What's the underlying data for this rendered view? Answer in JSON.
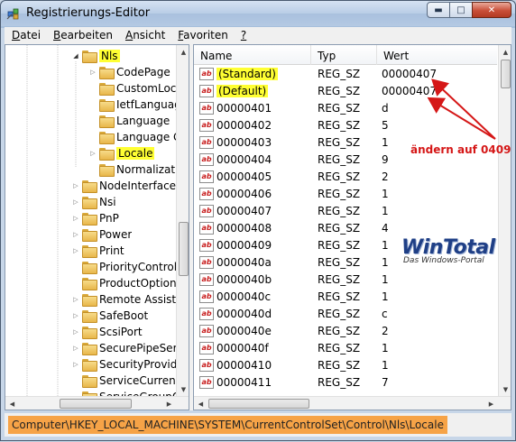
{
  "window": {
    "title": "Registrierungs-Editor"
  },
  "menu": [
    {
      "accel": "D",
      "rest": "atei"
    },
    {
      "accel": "B",
      "rest": "earbeiten"
    },
    {
      "accel": "A",
      "rest": "nsicht"
    },
    {
      "accel": "F",
      "rest": "avoriten"
    },
    {
      "accel": "?",
      "rest": ""
    }
  ],
  "tree": {
    "items": [
      {
        "label": "Nls",
        "expander": "open",
        "highlighted": true,
        "selected": false
      },
      {
        "label": "CodePage",
        "expander": "closed",
        "highlighted": false,
        "selected": false
      },
      {
        "label": "CustomLoc",
        "expander": "none",
        "highlighted": false,
        "selected": false
      },
      {
        "label": "IetfLanguag",
        "expander": "none",
        "highlighted": false,
        "selected": false
      },
      {
        "label": "Language",
        "expander": "none",
        "highlighted": false,
        "selected": false
      },
      {
        "label": "Language G",
        "expander": "none",
        "highlighted": false,
        "selected": false
      },
      {
        "label": "Locale",
        "expander": "closed",
        "highlighted": true,
        "selected": true
      },
      {
        "label": "Normalizati",
        "expander": "none",
        "highlighted": false,
        "selected": false
      },
      {
        "label": "NodeInterfaces",
        "expander": "closed",
        "highlighted": false,
        "selected": false
      },
      {
        "label": "Nsi",
        "expander": "closed",
        "highlighted": false,
        "selected": false
      },
      {
        "label": "PnP",
        "expander": "closed",
        "highlighted": false,
        "selected": false
      },
      {
        "label": "Power",
        "expander": "closed",
        "highlighted": false,
        "selected": false
      },
      {
        "label": "Print",
        "expander": "closed",
        "highlighted": false,
        "selected": false
      },
      {
        "label": "PriorityControl",
        "expander": "none",
        "highlighted": false,
        "selected": false
      },
      {
        "label": "ProductOptions",
        "expander": "none",
        "highlighted": false,
        "selected": false
      },
      {
        "label": "Remote Assista",
        "expander": "closed",
        "highlighted": false,
        "selected": false
      },
      {
        "label": "SafeBoot",
        "expander": "closed",
        "highlighted": false,
        "selected": false
      },
      {
        "label": "ScsiPort",
        "expander": "closed",
        "highlighted": false,
        "selected": false
      },
      {
        "label": "SecurePipeServ",
        "expander": "closed",
        "highlighted": false,
        "selected": false
      },
      {
        "label": "SecurityProvide",
        "expander": "closed",
        "highlighted": false,
        "selected": false
      },
      {
        "label": "ServiceCurrent",
        "expander": "none",
        "highlighted": false,
        "selected": false
      },
      {
        "label": "ServiceGroupOr",
        "expander": "none",
        "highlighted": false,
        "selected": false
      }
    ]
  },
  "list": {
    "columns": [
      "Name",
      "Typ",
      "Wert"
    ],
    "rows": [
      {
        "name": "(Standard)",
        "type": "REG_SZ",
        "value": "00000407",
        "highlighted": true
      },
      {
        "name": "(Default)",
        "type": "REG_SZ",
        "value": "00000407",
        "highlighted": true
      },
      {
        "name": "00000401",
        "type": "REG_SZ",
        "value": "d",
        "highlighted": false
      },
      {
        "name": "00000402",
        "type": "REG_SZ",
        "value": "5",
        "highlighted": false
      },
      {
        "name": "00000403",
        "type": "REG_SZ",
        "value": "1",
        "highlighted": false
      },
      {
        "name": "00000404",
        "type": "REG_SZ",
        "value": "9",
        "highlighted": false
      },
      {
        "name": "00000405",
        "type": "REG_SZ",
        "value": "2",
        "highlighted": false
      },
      {
        "name": "00000406",
        "type": "REG_SZ",
        "value": "1",
        "highlighted": false
      },
      {
        "name": "00000407",
        "type": "REG_SZ",
        "value": "1",
        "highlighted": false
      },
      {
        "name": "00000408",
        "type": "REG_SZ",
        "value": "4",
        "highlighted": false
      },
      {
        "name": "00000409",
        "type": "REG_SZ",
        "value": "1",
        "highlighted": false
      },
      {
        "name": "0000040a",
        "type": "REG_SZ",
        "value": "1",
        "highlighted": false
      },
      {
        "name": "0000040b",
        "type": "REG_SZ",
        "value": "1",
        "highlighted": false
      },
      {
        "name": "0000040c",
        "type": "REG_SZ",
        "value": "1",
        "highlighted": false
      },
      {
        "name": "0000040d",
        "type": "REG_SZ",
        "value": "c",
        "highlighted": false
      },
      {
        "name": "0000040e",
        "type": "REG_SZ",
        "value": "2",
        "highlighted": false
      },
      {
        "name": "0000040f",
        "type": "REG_SZ",
        "value": "1",
        "highlighted": false
      },
      {
        "name": "00000410",
        "type": "REG_SZ",
        "value": "1",
        "highlighted": false
      },
      {
        "name": "00000411",
        "type": "REG_SZ",
        "value": "7",
        "highlighted": false
      }
    ]
  },
  "icons": {
    "value_type_glyph": "ab"
  },
  "status": {
    "path": "Computer\\HKEY_LOCAL_MACHINE\\SYSTEM\\CurrentControlSet\\Control\\Nls\\Locale"
  },
  "annotation": {
    "text": "ändern auf 0409"
  },
  "watermark": {
    "main": "WinTotal",
    "sub": "Das Windows-Portal"
  },
  "colors": {
    "highlight": "#ffff33",
    "status_highlight": "#f6a347",
    "annotation": "#d51717"
  }
}
